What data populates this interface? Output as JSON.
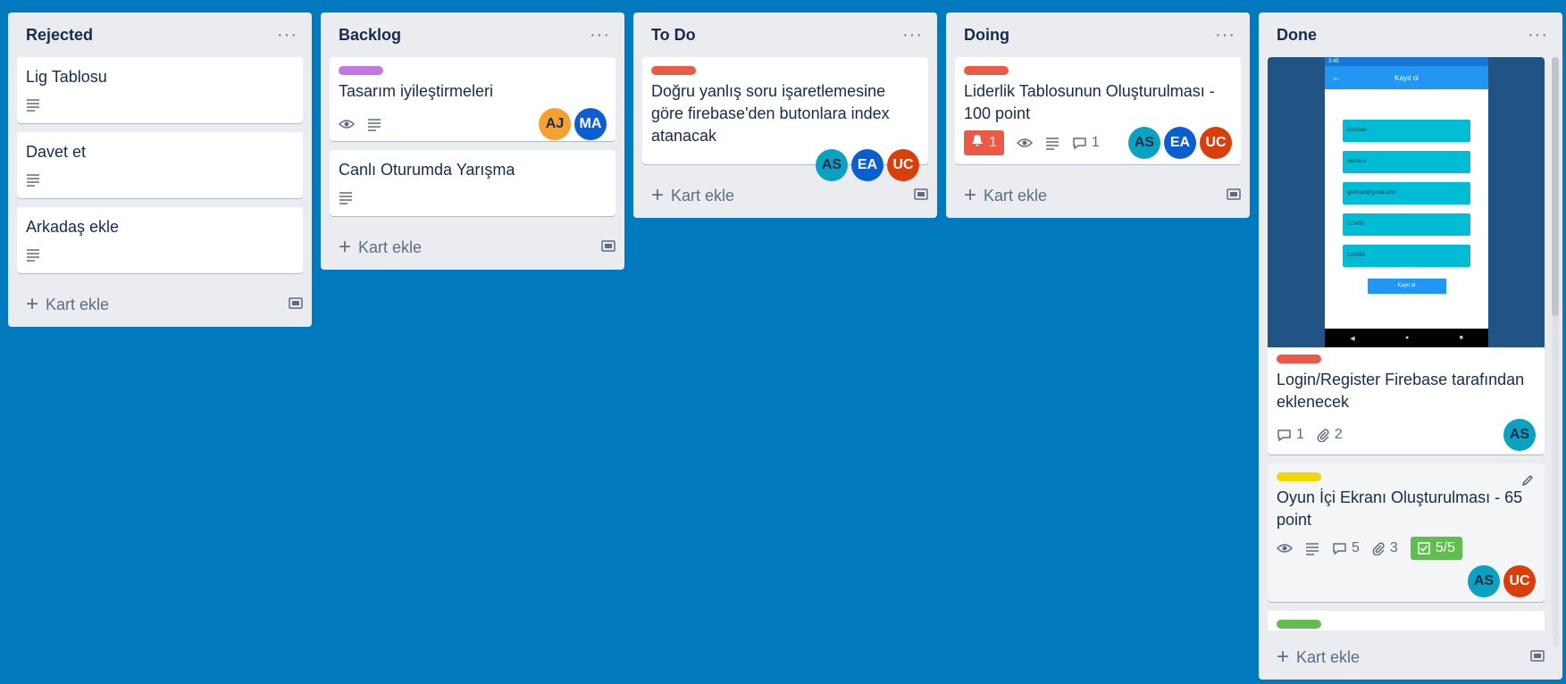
{
  "lists": {
    "rejected": {
      "title": "Rejected",
      "cards": [
        "Lig Tablosu",
        "Davet et",
        "Arkadaş ekle"
      ],
      "add_label": "Kart ekle"
    },
    "backlog": {
      "title": "Backlog",
      "cards": [
        {
          "title": "Tasarım iyileştirmeleri",
          "label_color": "#c377e0",
          "members": [
            "AJ",
            "MA"
          ]
        },
        {
          "title": "Canlı Oturumda Yarışma"
        }
      ],
      "add_label": "Kart ekle"
    },
    "todo": {
      "title": "To Do",
      "cards": [
        {
          "title": "Doğru yanlış soru işaretlemesine göre firebase'den butonlara index atanacak",
          "label_color": "#eb5a46",
          "members": [
            "AS",
            "EA",
            "UC"
          ]
        }
      ],
      "add_label": "Kart ekle"
    },
    "doing": {
      "title": "Doing",
      "cards": [
        {
          "title": "Liderlik Tablosunun Oluşturulması - 100 point",
          "label_color": "#eb5a46",
          "due": "1",
          "comments": "1",
          "members": [
            "AS",
            "EA",
            "UC"
          ]
        }
      ],
      "add_label": "Kart ekle"
    },
    "done": {
      "title": "Done",
      "cover": {
        "status_time": "3:45",
        "app_title": "Kayıt ol",
        "fields": [
          "Gazihan",
          "Alankus",
          "gazihan@gmail.com",
          "123456",
          "123456"
        ],
        "button": "Kayıt ol"
      },
      "cards": [
        {
          "title": "Login/Register Firebase tarafından eklenecek",
          "label_color": "#eb5a46",
          "comments": "1",
          "attachments": "2",
          "members": [
            "AS"
          ]
        },
        {
          "title": "Oyun İçi Ekranı Oluşturulması - 65 point",
          "label_color": "#f2d600",
          "comments": "5",
          "attachments": "3",
          "checklist": "5/5",
          "members": [
            "AS",
            "UC"
          ]
        },
        {
          "label_color": "#61bd4f"
        }
      ],
      "add_label": "Kart ekle"
    }
  },
  "colors": {
    "board_bg": "#0079bf",
    "list_bg": "#ebecf0",
    "avatar_AJ": "#f6a032",
    "avatar_MA": "#0c5fd1",
    "avatar_AS": "#0aa2c0",
    "avatar_EA": "#0b5ecd",
    "avatar_UC": "#d93f0b"
  }
}
